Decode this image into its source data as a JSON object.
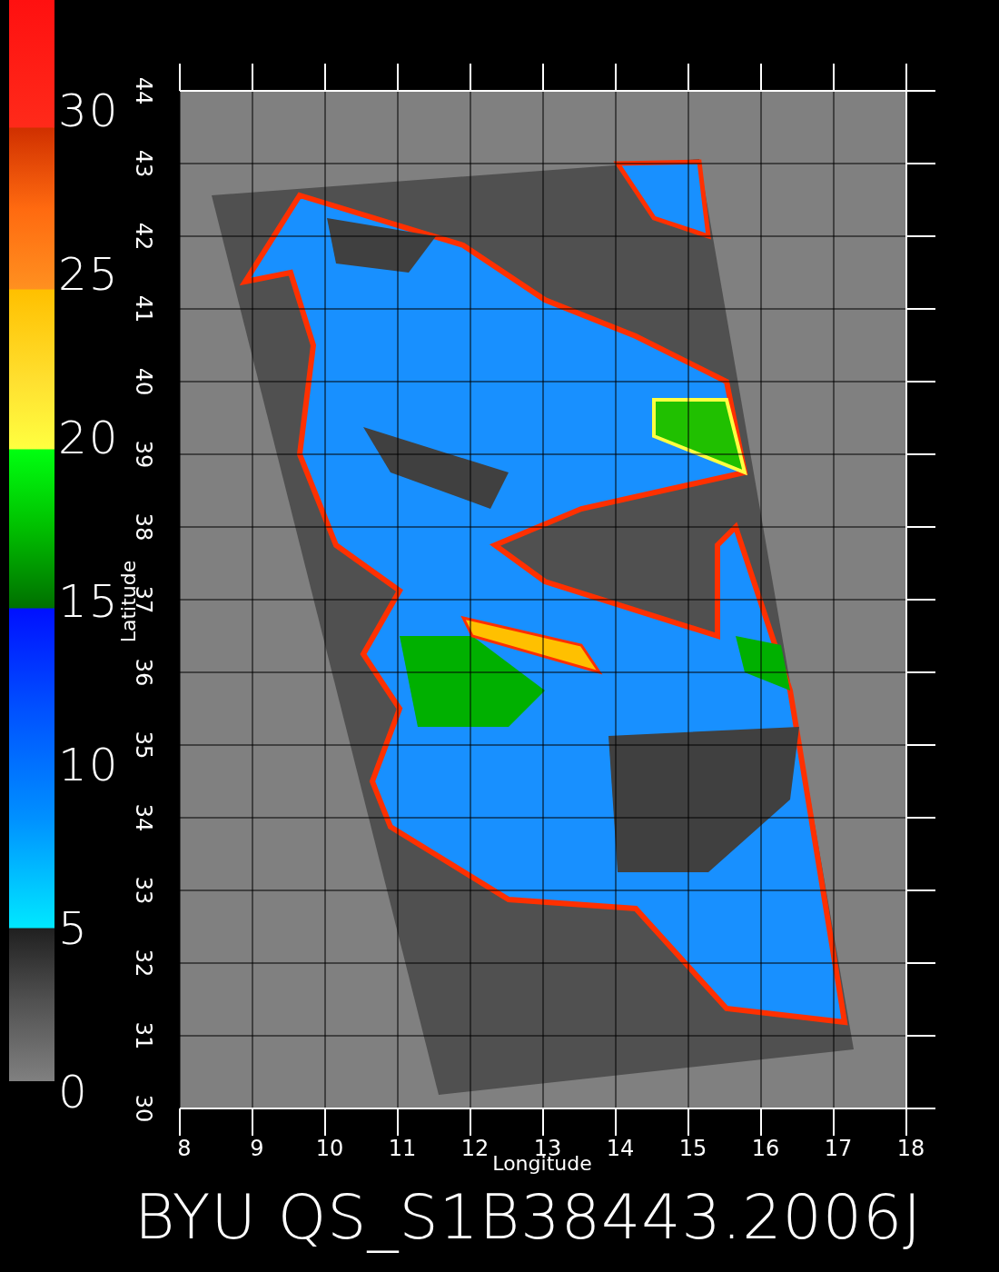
{
  "colorbar": {
    "labels": [
      "30",
      "25",
      "20",
      "15",
      "10",
      "5",
      "0"
    ]
  },
  "map": {
    "ylabel": "Latitude",
    "xlabel": "Longitude",
    "yticks": [
      "30",
      "31",
      "32",
      "33",
      "34",
      "35",
      "36",
      "37",
      "38",
      "39",
      "40",
      "41",
      "42",
      "43",
      "44"
    ],
    "xticks": [
      "8",
      "9",
      "10",
      "11",
      "12",
      "13",
      "14",
      "15",
      "16",
      "17",
      "18"
    ]
  },
  "title": "BYU QS_S1B38443.2006J"
}
